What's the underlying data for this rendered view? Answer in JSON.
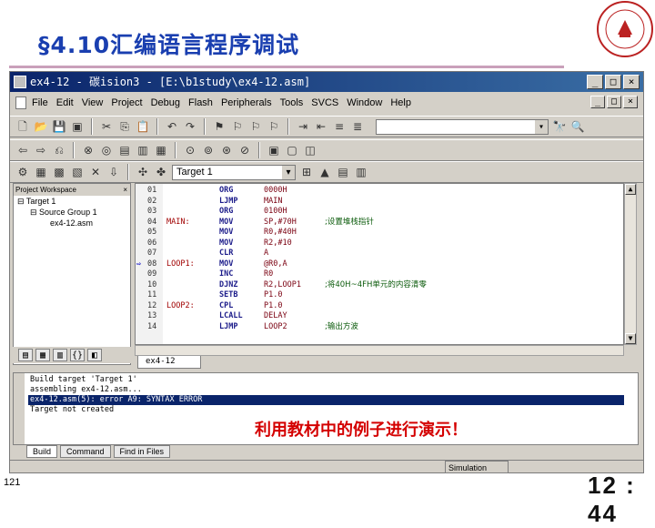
{
  "slide": {
    "title": "§4.10汇编语言程序调试",
    "caption": "利用教材中的例子进行演示！",
    "slide_number": "121",
    "clock": "12 : 44"
  },
  "window": {
    "title": "ex4-12  - 碳ision3 - [E:\\b1study\\ex4-12.asm]",
    "controls": [
      "_",
      "□",
      "×"
    ],
    "menu": [
      "File",
      "Edit",
      "View",
      "Project",
      "Debug",
      "Flash",
      "Peripherals",
      "Tools",
      "SVCS",
      "Window",
      "Help"
    ],
    "target": "Target 1"
  },
  "workspace": {
    "header": "Project Workspace",
    "close": "×",
    "tree": [
      "⊟ Target 1",
      "⊟ Source Group 1",
      "ex4-12.asm"
    ]
  },
  "editor": {
    "file_tab": "ex4-12",
    "lines": [
      {
        "n": "01",
        "label": "",
        "op": "ORG",
        "arg": "0000H",
        "comment": ""
      },
      {
        "n": "02",
        "label": "",
        "op": "LJMP",
        "arg": "MAIN",
        "comment": ""
      },
      {
        "n": "03",
        "label": "",
        "op": "ORG",
        "arg": "0100H",
        "comment": ""
      },
      {
        "n": "04",
        "label": "MAIN:",
        "op": "MOV",
        "arg": "SP,#70H",
        "comment": ";设置堆栈指针"
      },
      {
        "n": "05",
        "label": "",
        "op": "MOV",
        "arg": "R0,#40H",
        "comment": ""
      },
      {
        "n": "06",
        "label": "",
        "op": "MOV",
        "arg": "R2,#10",
        "comment": ""
      },
      {
        "n": "07",
        "label": "",
        "op": "CLR",
        "arg": "A",
        "comment": ""
      },
      {
        "n": "08",
        "label": "LOOP1:",
        "op": "MOV",
        "arg": "@R0,A",
        "comment": ""
      },
      {
        "n": "09",
        "label": "",
        "op": "INC",
        "arg": "R0",
        "comment": ""
      },
      {
        "n": "10",
        "label": "",
        "op": "DJNZ",
        "arg": "R2,LOOP1",
        "comment": ";将40H~4FH单元的内容清零"
      },
      {
        "n": "11",
        "label": "",
        "op": "SETB",
        "arg": "P1.0",
        "comment": ""
      },
      {
        "n": "12",
        "label": "LOOP2:",
        "op": "CPL",
        "arg": "P1.0",
        "comment": ""
      },
      {
        "n": "13",
        "label": "",
        "op": "LCALL",
        "arg": "DELAY",
        "comment": ""
      },
      {
        "n": "14",
        "label": "",
        "op": "LJMP",
        "arg": "LOOP2",
        "comment": ";输出方波"
      }
    ],
    "arrow": "⇨"
  },
  "output": {
    "lines": [
      "Build target 'Target 1'",
      "assembling ex4-12.asm...",
      "ex4-12.asm(5): error A9: SYNTAX ERROR",
      "Target not created"
    ],
    "selected_index": 2,
    "tabs": [
      "Build",
      "Command",
      "Find in Files"
    ]
  },
  "statusbar": {
    "mode": "Simulation"
  }
}
